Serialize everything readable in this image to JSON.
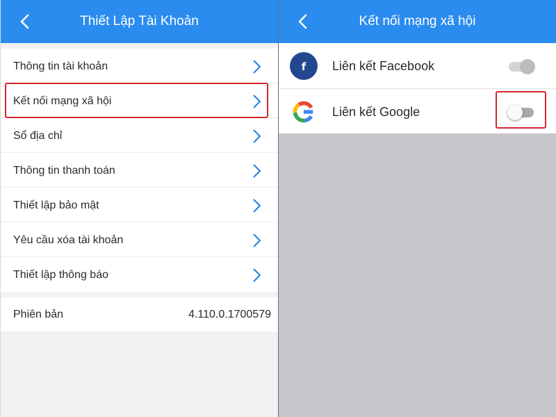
{
  "colors": {
    "header_blue": "#2b8cef",
    "chevron_blue": "#1f7fe0",
    "highlight_red": "#d6252d",
    "facebook_navy": "#24488f",
    "empty_area_gray": "#c7c6cc"
  },
  "left_screen": {
    "header": {
      "title": "Thiết Lập Tài Khoản",
      "back_icon": "chevron-left-icon"
    },
    "menu_items": [
      {
        "label": "Thông tin tài khoản"
      },
      {
        "label": "Kết nối mạng xã hội",
        "highlighted": true
      },
      {
        "label": "Sổ địa chỉ"
      },
      {
        "label": "Thông tin thanh toán"
      },
      {
        "label": "Thiết lập bảo mật"
      },
      {
        "label": "Yêu cầu xóa tài khoản"
      },
      {
        "label": "Thiết lập thông báo"
      }
    ],
    "version": {
      "label": "Phiên bản",
      "value": "4.110.0.1700579"
    }
  },
  "right_screen": {
    "header": {
      "title": "Kết nối mạng xã hội",
      "back_icon": "chevron-left-icon"
    },
    "items": [
      {
        "label": "Liên kết Facebook",
        "icon": "facebook-icon",
        "icon_letter": "f",
        "toggle_state": "on-disabled"
      },
      {
        "label": "Liên kết Google",
        "icon": "google-icon",
        "toggle_state": "off",
        "highlighted": true
      }
    ]
  }
}
